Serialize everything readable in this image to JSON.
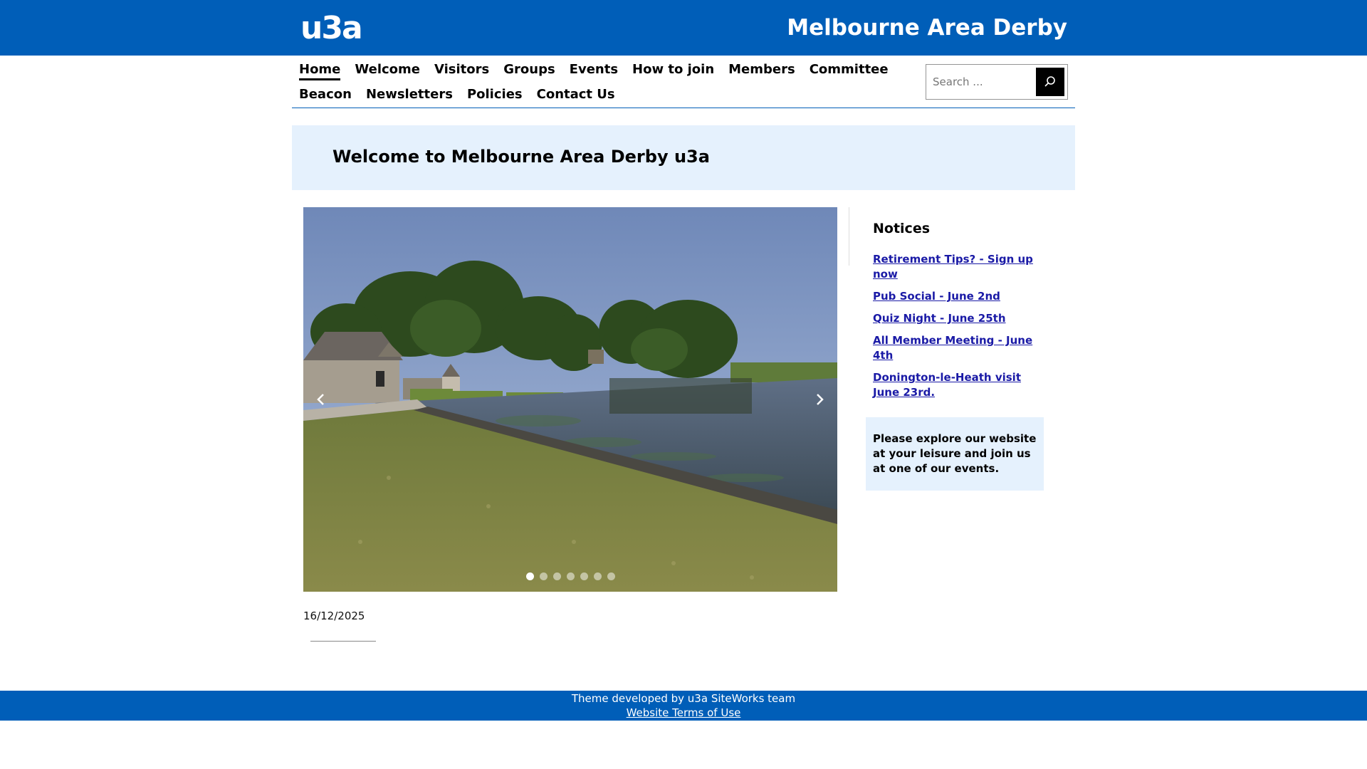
{
  "header": {
    "logo_text": "u3a",
    "site_title": "Melbourne Area Derby"
  },
  "nav": {
    "items": [
      {
        "label": "Home",
        "active": true
      },
      {
        "label": "Welcome"
      },
      {
        "label": "Visitors"
      },
      {
        "label": "Groups"
      },
      {
        "label": "Events"
      },
      {
        "label": "How to join"
      },
      {
        "label": "Members"
      },
      {
        "label": "Committee"
      },
      {
        "label": "Beacon"
      },
      {
        "label": "Newsletters"
      },
      {
        "label": "Policies"
      },
      {
        "label": "Contact Us"
      }
    ]
  },
  "search": {
    "placeholder": "Search ...",
    "button_icon": "search-icon"
  },
  "welcome": {
    "title": "Welcome to Melbourne Area Derby u3a"
  },
  "slider": {
    "image_description": "lakeside-village-scene",
    "prev_icon": "chevron-left-icon",
    "next_icon": "chevron-right-icon",
    "slide_count": 7,
    "active_slide": 1
  },
  "main": {
    "date": "16/12/2025"
  },
  "notices": {
    "title": "Notices",
    "items": [
      "Retirement Tips? - Sign up now",
      "Pub Social - June 2nd",
      "Quiz Night - June 25th",
      "All Member Meeting - June 4th",
      "Donington-le-Heath visit June 23rd."
    ]
  },
  "explore": {
    "text": "Please explore our website at your leisure and join us at one of our events."
  },
  "footer": {
    "credit": "Theme developed by u3a SiteWorks team",
    "terms_link": "Website Terms of Use"
  },
  "colors": {
    "brand_blue": "#005eb8",
    "light_blue_panel": "#e5f1fd",
    "link_blue": "#1a1aa6"
  }
}
